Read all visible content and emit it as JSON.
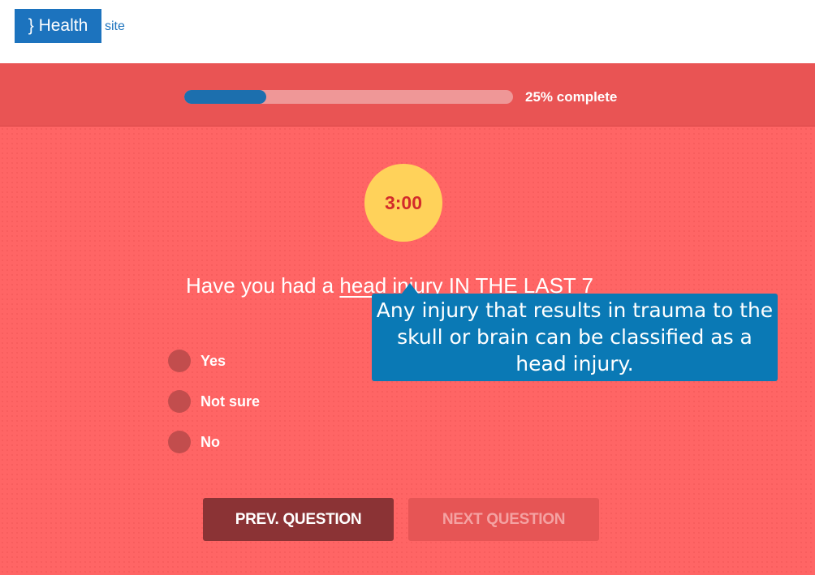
{
  "header": {
    "logo_text": "} Health",
    "logo_sub": "site"
  },
  "progress": {
    "fraction": 0.25,
    "label": "25% complete"
  },
  "timer": {
    "value": "3:00"
  },
  "question": {
    "prefix": "Have you had a ",
    "term": "head injury",
    "suffix": " IN THE LAST 7"
  },
  "tooltip": {
    "text": "Any injury that results in trauma to the skull or brain can be classified as a head injury."
  },
  "options": [
    {
      "label": "Yes"
    },
    {
      "label": "Not sure"
    },
    {
      "label": "No"
    }
  ],
  "buttons": {
    "prev": "PREV. QUESTION",
    "next": "NEXT QUESTION"
  },
  "colors": {
    "background": "#ff6565",
    "accent_blue": "#1c73be",
    "timer_yellow": "#ffd25a"
  }
}
